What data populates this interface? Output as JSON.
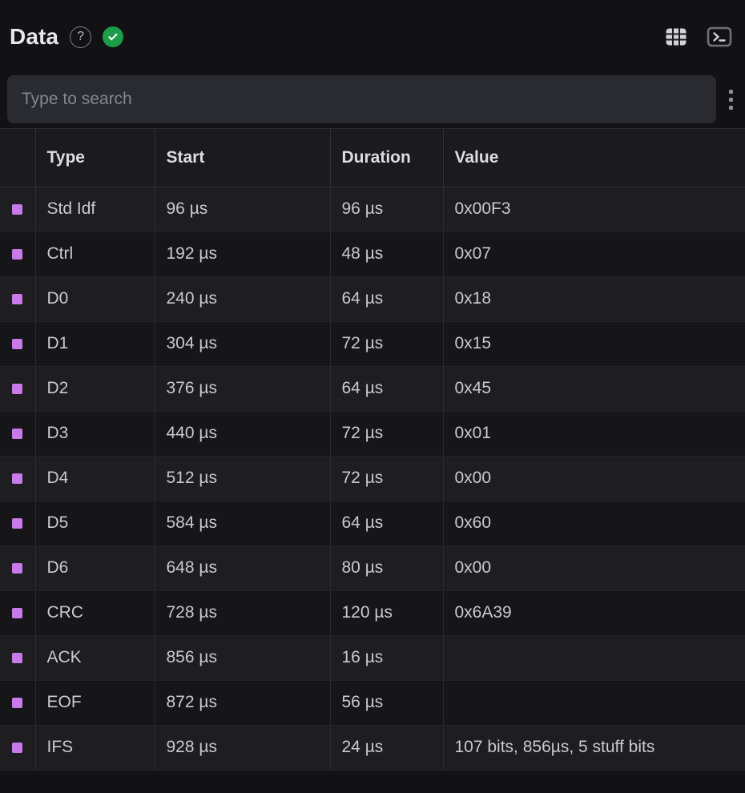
{
  "header": {
    "title": "Data",
    "help_icon_glyph": "?",
    "help_icon_name": "help-circle-icon",
    "status_icon_name": "check-circle-icon",
    "status_color": "#1d9c49",
    "actions": [
      {
        "name": "table-view-icon",
        "label": "Table view"
      },
      {
        "name": "terminal-icon",
        "label": "Terminal"
      }
    ]
  },
  "search": {
    "placeholder": "Type to search",
    "value": "",
    "menu_icon_name": "kebab-menu-icon"
  },
  "table": {
    "columns": [
      "",
      "Type",
      "Start",
      "Duration",
      "Value"
    ],
    "marker_color": "#c77ae8",
    "rows": [
      {
        "type": "Std Idf",
        "start": "96 µs",
        "duration": "96 µs",
        "value": "0x00F3"
      },
      {
        "type": "Ctrl",
        "start": "192 µs",
        "duration": "48 µs",
        "value": "0x07"
      },
      {
        "type": "D0",
        "start": "240 µs",
        "duration": "64 µs",
        "value": "0x18"
      },
      {
        "type": "D1",
        "start": "304 µs",
        "duration": "72 µs",
        "value": "0x15"
      },
      {
        "type": "D2",
        "start": "376 µs",
        "duration": "64 µs",
        "value": "0x45"
      },
      {
        "type": "D3",
        "start": "440 µs",
        "duration": "72 µs",
        "value": "0x01"
      },
      {
        "type": "D4",
        "start": "512 µs",
        "duration": "72 µs",
        "value": "0x00"
      },
      {
        "type": "D5",
        "start": "584 µs",
        "duration": "64 µs",
        "value": "0x60"
      },
      {
        "type": "D6",
        "start": "648 µs",
        "duration": "80 µs",
        "value": "0x00"
      },
      {
        "type": "CRC",
        "start": "728 µs",
        "duration": "120 µs",
        "value": "0x6A39"
      },
      {
        "type": "ACK",
        "start": "856 µs",
        "duration": "16 µs",
        "value": ""
      },
      {
        "type": "EOF",
        "start": "872 µs",
        "duration": "56 µs",
        "value": ""
      },
      {
        "type": "IFS",
        "start": "928 µs",
        "duration": "24 µs",
        "value": "107 bits, 856µs, 5 stuff bits"
      }
    ]
  }
}
